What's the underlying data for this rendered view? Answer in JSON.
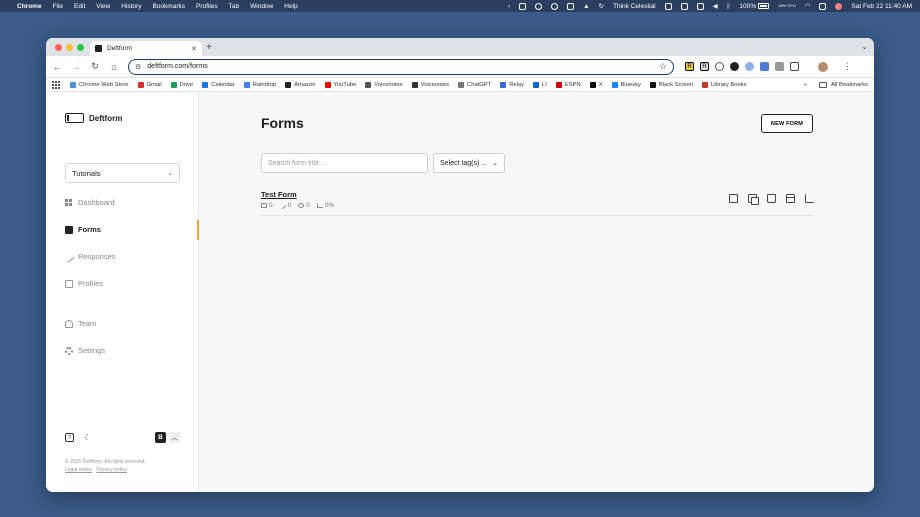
{
  "menubar": {
    "app": "Chrome",
    "items": [
      "File",
      "Edit",
      "View",
      "History",
      "Bookmarks",
      "Profiles",
      "Tab",
      "Window",
      "Help"
    ],
    "status_text": "Think Celestial",
    "battery": "100%",
    "cpu_label": "18% CPU",
    "datetime": "Sat Feb 22  11:40 AM"
  },
  "browser": {
    "tab_title": "Deftform",
    "url": "deftform.com/forms",
    "bookmarks": [
      "Chrome Web Store",
      "Gmail",
      "Drive",
      "Calendar",
      "Raindrop",
      "Amazon",
      "YouTube",
      "Voicenotes",
      "Voicenotes",
      "ChatGPT",
      "Relay",
      "LI",
      "ESPN",
      "X",
      "Bluesky",
      "Black Screen",
      "Library Books"
    ],
    "bookmark_colors": [
      "#4a90d9",
      "#d93025",
      "#1a9f5a",
      "#1a73e8",
      "#3b82f6",
      "#222222",
      "#ff0000",
      "#555555",
      "#333333",
      "#777777",
      "#3a66d6",
      "#0a66c2",
      "#cc0000",
      "#000000",
      "#1185fe",
      "#111111",
      "#c0392b"
    ],
    "bookmarks_more": "»",
    "all_bookmarks": "All Bookmarks"
  },
  "sidebar": {
    "brand": "Deftform",
    "workspace_select": "Tutorials",
    "nav": [
      {
        "label": "Dashboard",
        "icon": "grid-icon"
      },
      {
        "label": "Forms",
        "icon": "forms-icon"
      },
      {
        "label": "Responses",
        "icon": "pen-icon"
      },
      {
        "label": "Profiles",
        "icon": "profile-icon"
      },
      {
        "label": "Team",
        "icon": "team-icon"
      },
      {
        "label": "Settings",
        "icon": "gear-icon"
      }
    ],
    "account_initial": "B",
    "copyright": "© 2025 Deftform. All rights reserved.",
    "legal_notice": "Legal notice",
    "separator": " · ",
    "privacy_policy": "Privacy policy"
  },
  "main": {
    "title": "Forms",
    "new_form_label": "NEW FORM",
    "search_placeholder": "Search form title ...",
    "tag_select_label": "Select tag(s) ...",
    "forms": [
      {
        "name": "Test Form",
        "submissions": "0",
        "partial": "0",
        "views": "0",
        "conversion": "0%"
      }
    ]
  },
  "colors": {
    "accent": "#f5a623",
    "chat_button": "#f26b22",
    "desktop": "#3b5b8a"
  }
}
